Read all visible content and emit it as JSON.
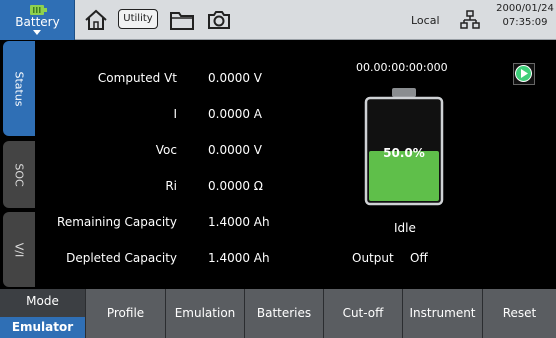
{
  "topbar": {
    "battery_label": "Battery",
    "utility_label": "Utility",
    "local_label": "Local",
    "date": "2000/01/24",
    "time": "07:35:09"
  },
  "side_tabs": [
    "Status",
    "SOC",
    "V/I"
  ],
  "status": {
    "rows": [
      {
        "label": "Computed Vt",
        "value": "0.0000 V"
      },
      {
        "label": "I",
        "value": "0.0000 A"
      },
      {
        "label": "Voc",
        "value": "0.0000 V"
      },
      {
        "label": "Ri",
        "value": "0.0000 Ω"
      },
      {
        "label": "Remaining Capacity",
        "value": "1.4000 Ah"
      },
      {
        "label": "Depleted Capacity",
        "value": "1.4000 Ah"
      }
    ],
    "elapsed": "00.00:00:00:000",
    "soc_percent": "50.0%",
    "soc_fraction": 0.5,
    "state": "Idle",
    "output_label": "Output",
    "output_value": "Off"
  },
  "bottombar": {
    "mode_label": "Mode",
    "mode_value": "Emulator",
    "buttons": [
      "Profile",
      "Emulation",
      "Batteries",
      "Cut-off",
      "Instrument",
      "Reset"
    ]
  },
  "colors": {
    "accent": "#2f6fb5",
    "battery_fill": "#5fbf4a",
    "play_icon": "#3fcf7a"
  },
  "icons": [
    "battery-icon",
    "home-icon",
    "folder-icon",
    "camera-icon",
    "network-icon",
    "play-icon"
  ]
}
